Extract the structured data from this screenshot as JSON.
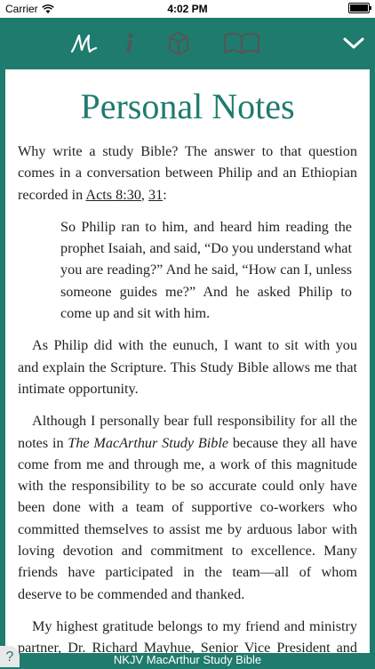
{
  "status_bar": {
    "carrier": "Carrier",
    "time": "4:02 PM",
    "battery_level": 0.92
  },
  "toolbar": {
    "icons": [
      "signature-icon",
      "info-icon",
      "cube-icon",
      "book-icon",
      "chevron-down-icon"
    ]
  },
  "article": {
    "title": "Personal Notes",
    "p1_text": "Why write a study Bible? The answer to that question comes in a conversation between Philip and an Ethiopian recorded in ",
    "p1_ref1": "Acts 8:30",
    "p1_sep": ", ",
    "p1_ref2": "31",
    "p1_end": ":",
    "quote": "So Philip ran to him, and heard him reading the prophet Isaiah, and said, “Do you understand what you are reading?” And he said, “How can I, unless someone guides me?” And he asked Philip to come up and sit with him.",
    "p2": "As Philip did with the eunuch, I want to sit with you and explain the Scripture. This Study Bible allows me that intimate opportunity.",
    "p3_start": "Although I personally bear full responsibility for all the notes in ",
    "p3_title": "The MacArthur Study Bible",
    "p3_end": " because they all have come from me and through me, a work of this magnitude with the responsibility to be so accurate could only have been done with a team of supportive co-workers who committed themselves to assist me by arduous labor with loving devotion and commitment to excellence. Many friends have participated in the team—all of whom deserve to be commended and thanked.",
    "p4": "My highest gratitude belongs to my friend and ministry partner, Dr. Richard Mayhue, Senior Vice President and Dean of The Master’s Seminary. He labored alongside"
  },
  "footer": {
    "title": "NKJV MacArthur Study Bible",
    "help_label": "?"
  }
}
